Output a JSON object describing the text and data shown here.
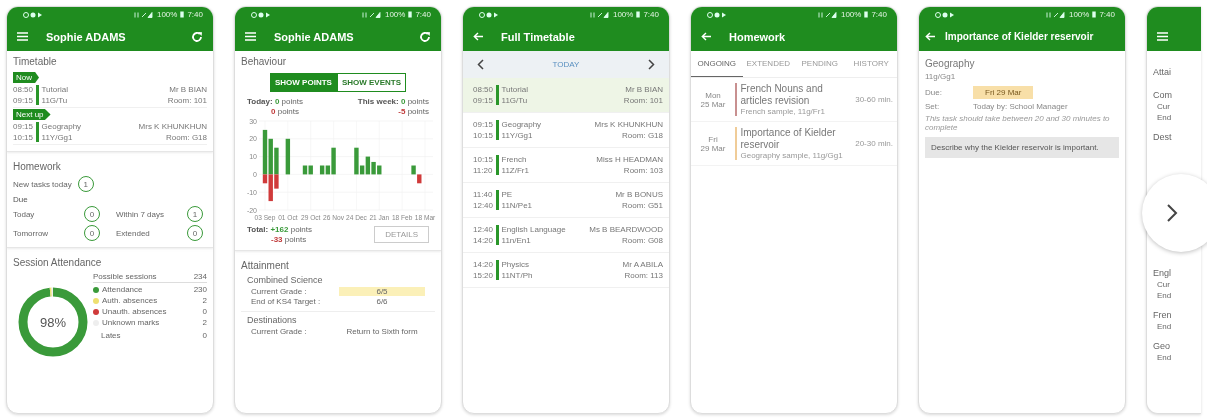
{
  "dashboard": {
    "status_bar": {
      "battery": "100%",
      "time": "7:40"
    },
    "app_bar": {
      "title": "Sophie ADAMS"
    },
    "timetable": {
      "title": "Timetable",
      "slots": [
        {
          "badge": "Now",
          "start": "08:50",
          "end": "09:15",
          "subject": "Tutorial",
          "group": "11G/Tu",
          "teacher": "Mr B BIAN",
          "room": "Room: 101"
        },
        {
          "badge": "Next up",
          "start": "09:15",
          "end": "10:15",
          "subject": "Geography",
          "group": "11Y/Gg1",
          "teacher": "Mrs K KHUNKHUN",
          "room": "Room: G18"
        }
      ]
    },
    "homework": {
      "title": "Homework",
      "new_label": "New tasks today",
      "new_count": "1",
      "due_label": "Due",
      "counts": [
        {
          "label": "Today",
          "count": "0"
        },
        {
          "label": "Within 7 days",
          "count": "1"
        },
        {
          "label": "Tomorrow",
          "count": "0"
        },
        {
          "label": "Extended",
          "count": "0"
        }
      ]
    },
    "attendance": {
      "title": "Session Attendance",
      "percent": "98%",
      "possible_label": "Possible sessions",
      "possible": "234",
      "legend": [
        {
          "label": "Attendance",
          "value": "230",
          "color": "#3a9a3a"
        },
        {
          "label": "Auth. absences",
          "value": "2",
          "color": "#eee070"
        },
        {
          "label": "Unauth. absences",
          "value": "0",
          "color": "#d03a3a"
        },
        {
          "label": "Unknown marks",
          "value": "2",
          "color": "#eeeeee"
        }
      ],
      "lates_label": "Lates",
      "lates": "0"
    }
  },
  "behaviour": {
    "status_bar": {
      "battery": "100%",
      "time": "7:40"
    },
    "app_bar": {
      "title": "Sophie ADAMS"
    },
    "title": "Behaviour",
    "toggles": [
      {
        "label": "SHOW POINTS",
        "selected": true
      },
      {
        "label": "SHOW EVENTS",
        "selected": false
      }
    ],
    "today": {
      "label": "Today:",
      "positive": "0",
      "positive_unit": "points",
      "negative": "0",
      "negative_unit": "points"
    },
    "week": {
      "label": "This week:",
      "positive": "0",
      "positive_unit": "points",
      "negative": "-5",
      "negative_unit": "points"
    },
    "chart_data": {
      "type": "bar",
      "stacked": true,
      "grid": true,
      "categories": [
        "03 Sep",
        null,
        null,
        null,
        "01 Oct",
        null,
        null,
        null,
        "29 Oct",
        null,
        null,
        null,
        "26 Nov",
        null,
        null,
        null,
        "24 Dec",
        null,
        null,
        null,
        "21 Jan",
        null,
        null,
        null,
        "18 Feb",
        null,
        null,
        null,
        "18 Mar"
      ],
      "ylim": [
        -20,
        30
      ],
      "yticks": [
        -20,
        -10,
        0,
        10,
        20,
        30
      ],
      "series": [
        {
          "color": "#3a9a3a",
          "values": [
            25,
            20,
            15,
            null,
            20,
            null,
            null,
            5,
            5,
            null,
            5,
            5,
            15,
            null,
            null,
            null,
            15,
            5,
            10,
            7,
            5,
            null,
            null,
            null,
            null,
            null,
            5,
            null,
            null
          ]
        },
        {
          "color": "#d03a3a",
          "values": [
            -5,
            -15,
            -8,
            null,
            null,
            null,
            null,
            null,
            null,
            null,
            null,
            null,
            null,
            null,
            null,
            null,
            null,
            null,
            null,
            null,
            null,
            null,
            null,
            null,
            null,
            null,
            null,
            -5,
            null
          ]
        }
      ]
    },
    "total": {
      "label": "Total:",
      "positive": "+162",
      "positive_unit": "points",
      "negative": "-33",
      "negative_unit": "points"
    },
    "details_button": "DETAILS",
    "attainment": {
      "title": "Attainment",
      "subject": "Combined Science",
      "rows": [
        {
          "label": "Current Grade :",
          "value": "6/5",
          "highlighted": true
        },
        {
          "label": "End of KS4 Target :",
          "value": "6/6",
          "highlighted": false
        }
      ]
    },
    "destinations": {
      "title": "Destinations",
      "label": "Current Grade :",
      "value": "Return to Sixth form"
    }
  },
  "full_timetable": {
    "status_bar": {
      "battery": "100%",
      "time": "7:40"
    },
    "app_bar": {
      "title": "Full Timetable"
    },
    "day_label": "TODAY",
    "lessons": [
      {
        "start": "08:50",
        "end": "09:15",
        "subject": "Tutorial",
        "group": "11G/Tu",
        "teacher": "Mr B BIAN",
        "room": "Room: 101",
        "selected": true
      },
      {
        "start": "09:15",
        "end": "10:15",
        "subject": "Geography",
        "group": "11Y/Gg1",
        "teacher": "Mrs K KHUNKHUN",
        "room": "Room: G18",
        "selected": false
      },
      {
        "start": "10:15",
        "end": "11:20",
        "subject": "French",
        "group": "11Z/Fr1",
        "teacher": "Miss H HEADMAN",
        "room": "Room: 103",
        "selected": false
      },
      {
        "start": "11:40",
        "end": "12:40",
        "subject": "PE",
        "group": "11N/Pe1",
        "teacher": "Mr B BONUS",
        "room": "Room: G51",
        "selected": false
      },
      {
        "start": "12:40",
        "end": "14:20",
        "subject": "English Language",
        "group": "11n/En1",
        "teacher": "Ms B BEARDWOOD",
        "room": "Room: G08",
        "selected": false
      },
      {
        "start": "14:20",
        "end": "15:20",
        "subject": "Physics",
        "group": "11NT/Ph",
        "teacher": "Mr A ABILA",
        "room": "Room: 113",
        "selected": false
      }
    ]
  },
  "homework_list": {
    "status_bar": {
      "battery": "100%",
      "time": "7:40"
    },
    "app_bar": {
      "title": "Homework"
    },
    "tabs": [
      {
        "label": "ONGOING",
        "selected": true
      },
      {
        "label": "EXTENDED",
        "selected": false
      },
      {
        "label": "PENDING",
        "selected": false
      },
      {
        "label": "HISTORY",
        "selected": false
      }
    ],
    "items": [
      {
        "day": "Mon",
        "date": "25 Mar",
        "title": "French Nouns and articles revision",
        "detail": "French sample, 11g/Fr1",
        "duration": "30-60 min.",
        "color": "#c89090"
      },
      {
        "day": "Fri",
        "date": "29 Mar",
        "title": "Importance of Kielder reservoir",
        "detail": "Geography sample, 11g/Gg1",
        "duration": "20-30 min.",
        "color": "#f0cc98"
      }
    ]
  },
  "homework_detail": {
    "status_bar": {
      "battery": "100%",
      "time": "7:40"
    },
    "app_bar": {
      "title": "Importance of Kielder reservoir"
    },
    "subject": "Geography",
    "group": "11g/Gg1",
    "due_label": "Due:",
    "due": "Fri 29 Mar",
    "set_label": "Set:",
    "set": "Today by: School Manager",
    "note": "This task should take between 20 and 30 minutes to complete",
    "description": "Describe why the Kielder reservoir is important."
  },
  "partial_screen": {
    "texts": [
      {
        "kind": "heading",
        "text": "Attai"
      },
      {
        "kind": "subject",
        "text": "Com"
      },
      {
        "kind": "row",
        "text": "Cur"
      },
      {
        "kind": "row",
        "text": "End"
      },
      {
        "kind": "subject",
        "text": "Dest"
      },
      {
        "kind": "subject_after_gap",
        "text": "Engl"
      },
      {
        "kind": "row",
        "text": "Cur"
      },
      {
        "kind": "row",
        "text": "End"
      },
      {
        "kind": "subject",
        "text": "Fren"
      },
      {
        "kind": "row",
        "text": "End"
      },
      {
        "kind": "subject",
        "text": "Geo"
      },
      {
        "kind": "row",
        "text": "End"
      }
    ]
  }
}
